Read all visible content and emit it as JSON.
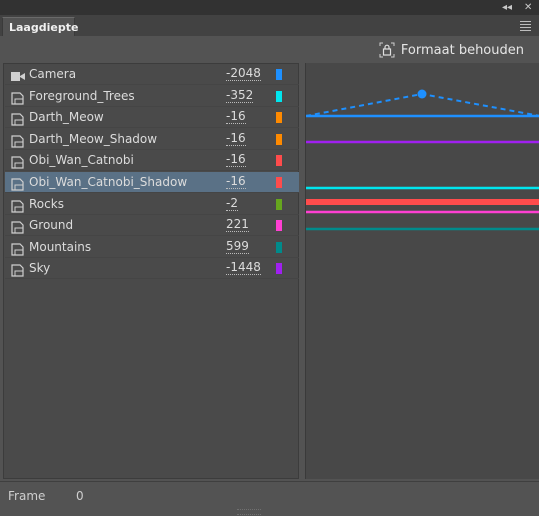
{
  "panel": {
    "title": "Laagdiepte",
    "collapse_glyph": "◂◂",
    "close_glyph": "✕",
    "menu_icon": "panel-menu-icon",
    "keep_format_label": "Formaat behouden"
  },
  "layers": [
    {
      "name": "Camera",
      "value": "-2048",
      "color": "#1e90ff",
      "icon": "camera-icon"
    },
    {
      "name": "Foreground_Trees",
      "value": "-352",
      "color": "#00e5ee",
      "icon": "layer-icon"
    },
    {
      "name": "Darth_Meow",
      "value": "-16",
      "color": "#ff8a00",
      "icon": "layer-icon"
    },
    {
      "name": "Darth_Meow_Shadow",
      "value": "-16",
      "color": "#ff8a00",
      "icon": "layer-icon"
    },
    {
      "name": "Obi_Wan_Catnobi",
      "value": "-16",
      "color": "#ff4c4c",
      "icon": "layer-icon"
    },
    {
      "name": "Obi_Wan_Catnobi_Shadow",
      "value": "-16",
      "color": "#ff4c4c",
      "icon": "layer-icon",
      "selected": true
    },
    {
      "name": "Rocks",
      "value": "-2",
      "color": "#66a61e",
      "icon": "layer-icon"
    },
    {
      "name": "Ground",
      "value": "221",
      "color": "#ff3fd2",
      "icon": "layer-icon"
    },
    {
      "name": "Mountains",
      "value": "599",
      "color": "#008b8b",
      "icon": "layer-icon"
    },
    {
      "name": "Sky",
      "value": "-1448",
      "color": "#a020f0",
      "icon": "layer-icon"
    }
  ],
  "graph": {
    "colors": {
      "camera": "#1e90ff",
      "purple": "#a020f0",
      "cyan": "#00e5ee",
      "red": "#ff4c4c",
      "magenta": "#ff3fd2",
      "teal": "#008b8b"
    }
  },
  "footer": {
    "frame_label": "Frame",
    "frame_value": "0"
  }
}
